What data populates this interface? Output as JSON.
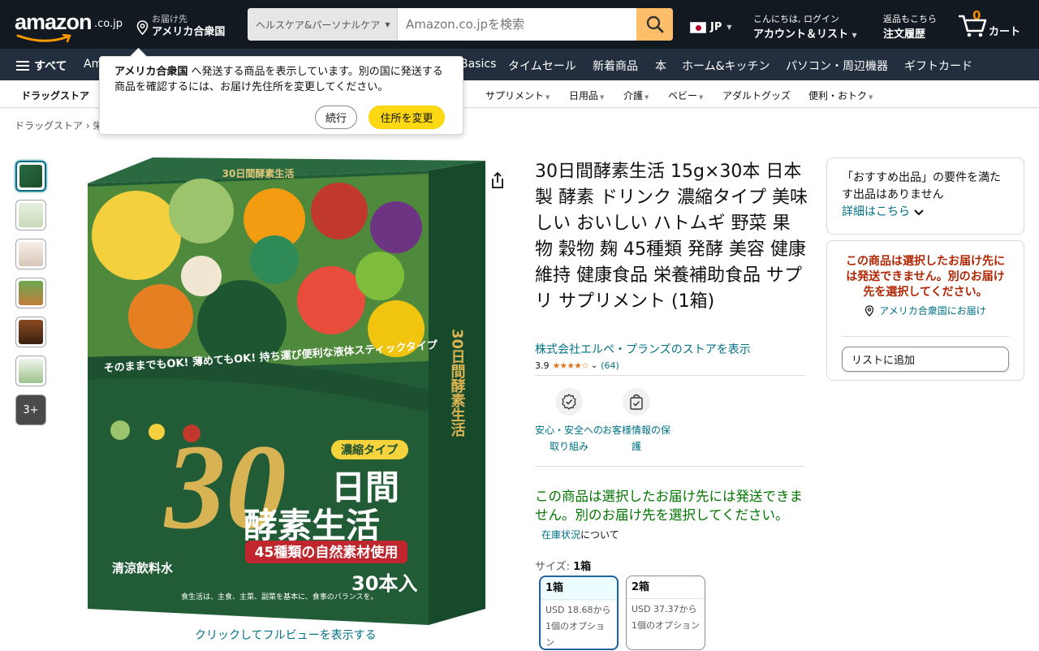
{
  "header": {
    "logo_text": "amazon",
    "logo_tld": ".co.jp",
    "deliver_to_label": "お届け先",
    "deliver_to_location": "アメリカ合衆国",
    "search_category": "ヘルスケア&パーソナルケア",
    "search_placeholder": "Amazon.co.jpを検索",
    "language": "JP",
    "account_greeting": "こんにちは, ログイン",
    "account_label": "アカウント＆リスト",
    "orders_line1": "返品もこちら",
    "orders_line2": "注文履歴",
    "cart_count": "0",
    "cart_label": "カート"
  },
  "navbar": {
    "all_label": "すべて",
    "items": [
      "Am",
      "Basics",
      "タイムセール",
      "新着商品",
      "本",
      "ホーム&キッチン",
      "パソコン・周辺機器",
      "ギフトカード"
    ]
  },
  "subnav": {
    "title": "ドラッグストア",
    "items": [
      "サプリメント",
      "日用品",
      "介護",
      "ベビー",
      "アダルトグッズ",
      "便利・おトク"
    ]
  },
  "breadcrumb": "ドラッグストア › 栄",
  "popover": {
    "bold": "アメリカ合衆国",
    "message": " へ発送する商品を表示しています。別の国に発送する商品を確認するには、お届け先住所を変更してください。",
    "continue_label": "続行",
    "change_label": "住所を変更"
  },
  "thumbnails": {
    "more_label": "3+"
  },
  "product_image": {
    "top_label": "30日間酵素生活",
    "tagline": "そのままでもOK! 薄めてもOK! 持ち運び便利な液体スティックタイプ",
    "type_badge": "濃縮タイプ",
    "big_number": "30",
    "name_line1": "日間",
    "name_line2": "酵素生活",
    "red_banner": "45種類の自然素材使用",
    "drink_type": "清涼飲料水",
    "count": "30本入",
    "footnote": "食生活は、主食、主菜、副菜を基本に、食事のバランスを。",
    "side_text": "30日間酵素生活"
  },
  "fullview_label": "クリックしてフルビューを表示する",
  "product": {
    "title": "30日間酵素生活 15g×30本 日本製 酵素 ドリンク 濃縮タイプ 美味しい おいしい ハトムギ 野菜 果物 穀物 麹 45種類 発酵 美容 健康維持 健康食品 栄養補助食品 サプリ サプリメント (1箱)",
    "store_link": "株式会社エルペ・プランズのストアを表示",
    "rating": "3.9",
    "stars": "★★★★☆",
    "review_count": "(64)",
    "badges": [
      {
        "label": "安心・安全への取り組み"
      },
      {
        "label": "お客様情報の保護"
      }
    ],
    "availability": "この商品は選択したお届け先には発送できません。別のお届け先を選択してください。",
    "stock_link": "在庫状況",
    "stock_suffix": "について",
    "size_label": "サイズ: ",
    "size_value": "1箱",
    "sizes": [
      {
        "name": "1箱",
        "price": "USD 18.68から",
        "note": "1個のオプション"
      },
      {
        "name": "2箱",
        "price": "USD 37.37から",
        "note": "1個のオプション"
      }
    ]
  },
  "buybox": {
    "recommend_text": "「おすすめ出品」の要件を満たす出品はありません",
    "details_link": "詳細はこちら",
    "warning": "この商品は選択したお届け先には発送できません。別のお届け先を選択してください。",
    "ship_to": "アメリカ合衆国にお届け",
    "add_to_list": "リストに追加"
  },
  "colors": {
    "nav_dark": "#131921",
    "nav_secondary": "#232f3e",
    "search_button": "#febd69",
    "link": "#007185",
    "in_green": "#007600",
    "warning_red": "#b12704",
    "button_yellow": "#ffd814",
    "package_green": "#1f5a3a"
  }
}
